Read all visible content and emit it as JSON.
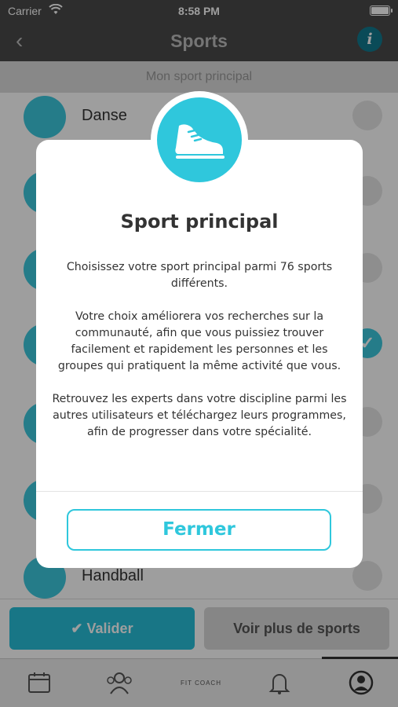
{
  "status_bar": {
    "carrier": "Carrier",
    "time": "8:58 PM",
    "icons": [
      "wifi-icon",
      "battery-icon"
    ]
  },
  "nav": {
    "title": "Sports",
    "back_icon": "chevron-left-icon",
    "info_icon": "info-icon",
    "info_glyph": "i"
  },
  "section_header": "Mon sport principal",
  "sports": [
    {
      "name": "Danse",
      "selected": false
    },
    {
      "name": "",
      "selected": false
    },
    {
      "name": "",
      "selected": false
    },
    {
      "name": "",
      "selected": true
    },
    {
      "name": "",
      "selected": false
    },
    {
      "name": "",
      "selected": false
    },
    {
      "name": "Handball",
      "selected": false
    }
  ],
  "actions": {
    "validate": "Valider",
    "validate_check": "✔",
    "more": "Voir plus de sports"
  },
  "tabbar": {
    "items": [
      "calendar-icon",
      "group-icon",
      "fit-coach-logo",
      "bell-icon",
      "profile-icon"
    ],
    "logo_text": "FIT COACH"
  },
  "modal": {
    "icon": "running-shoe-icon",
    "title": "Sport principal",
    "paragraphs": [
      "Choisissez votre sport principal parmi 76 sports différents.",
      "Votre choix améliorera vos recherches sur la communauté, afin que vous puissiez trouver facilement et rapidement les personnes et les groupes qui pratiquent la même activité que vous.",
      "Retrouvez les experts dans votre discipline parmi les autres utilisateurs et téléchargez leurs programmes, afin de progresser dans votre spécialité."
    ],
    "close_label": "Fermer"
  },
  "colors": {
    "accent": "#2fc7dc",
    "nav_bg": "#4a4a4a"
  }
}
